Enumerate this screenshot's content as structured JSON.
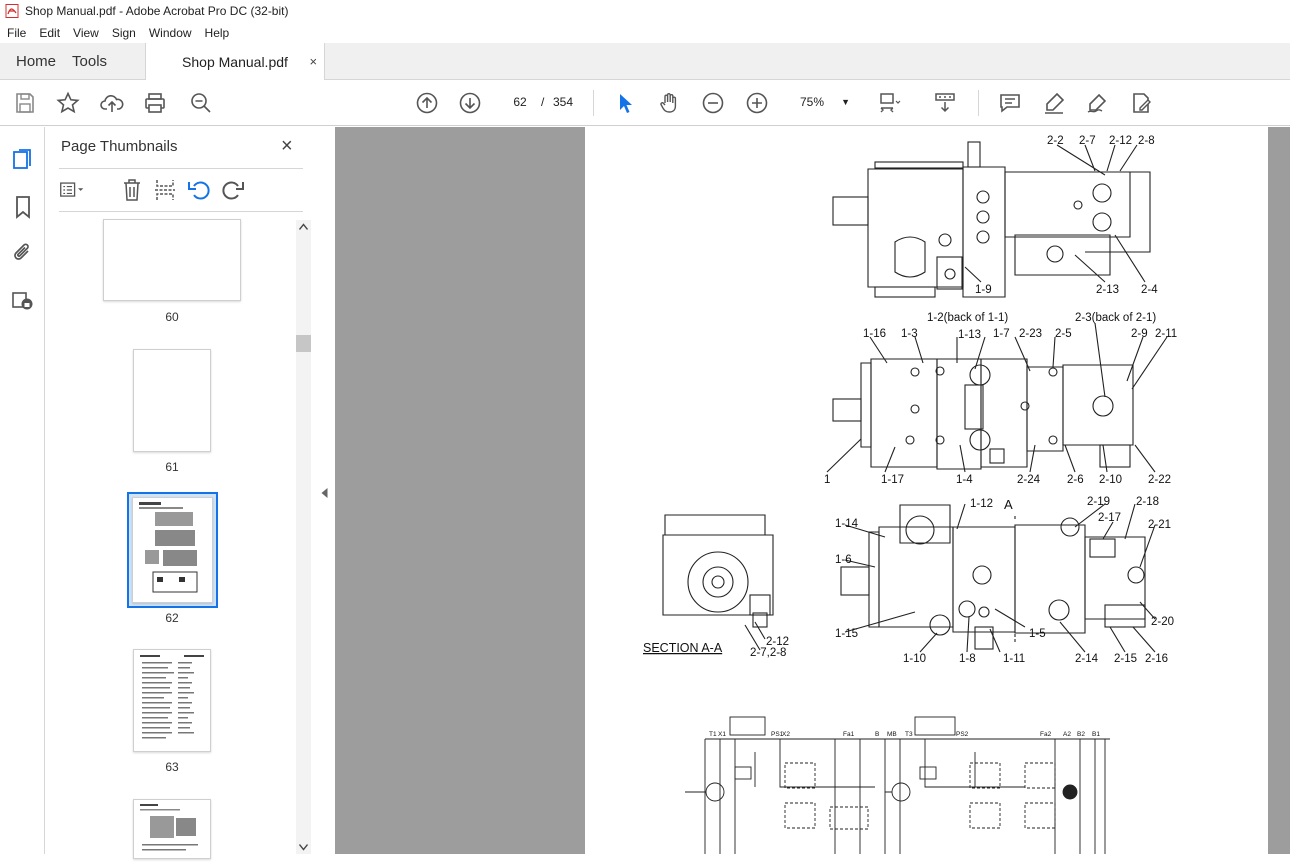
{
  "window": {
    "title": "Shop Manual.pdf - Adobe Acrobat Pro DC (32-bit)"
  },
  "menu": [
    "File",
    "Edit",
    "View",
    "Sign",
    "Window",
    "Help"
  ],
  "tabs": {
    "home": "Home",
    "tools": "Tools",
    "document": "Shop Manual.pdf",
    "close": "×"
  },
  "toolbar": {
    "current_page": "62",
    "separator": "/",
    "total_pages": "354",
    "zoom": "75%"
  },
  "panel": {
    "title": "Page Thumbnails",
    "close": "×",
    "thumbnails": [
      {
        "label": "60"
      },
      {
        "label": "61"
      },
      {
        "label": "62",
        "selected": true
      },
      {
        "label": "63"
      }
    ]
  },
  "document": {
    "section_label": "SECTION A-A",
    "labels_fig1": [
      "2-2",
      "2-7",
      "2-12",
      "2-8",
      "1-9",
      "2-13",
      "2-4"
    ],
    "labels_fig2": [
      "1-2(back of 1-1)",
      "2-3(back of 2-1)",
      "1-16",
      "1-3",
      "1-13",
      "1-7",
      "2-23",
      "2-5",
      "2-9",
      "2-11",
      "1",
      "1-17",
      "1-4",
      "2-24",
      "2-6",
      "2-10",
      "2-22"
    ],
    "labels_fig3": [
      "1-12",
      "A",
      "2-19",
      "2-18",
      "1-14",
      "2-17",
      "2-21",
      "1-6",
      "1-15",
      "1-5",
      "2-20",
      "1-10",
      "1-8",
      "1-11",
      "2-14",
      "2-15",
      "2-16"
    ],
    "labels_section": [
      "2-12",
      "2-7,2-8"
    ],
    "schematic_labels": [
      "T1",
      "X1",
      "PS1",
      "X2",
      "Fa1",
      "B",
      "MB",
      "T3",
      "PS2",
      "Fa2",
      "A2",
      "B2",
      "B1"
    ]
  },
  "colors": {
    "accent": "#1473e6",
    "viewer_bg": "#9d9d9d",
    "pdf_icon": "#d32f2f"
  }
}
